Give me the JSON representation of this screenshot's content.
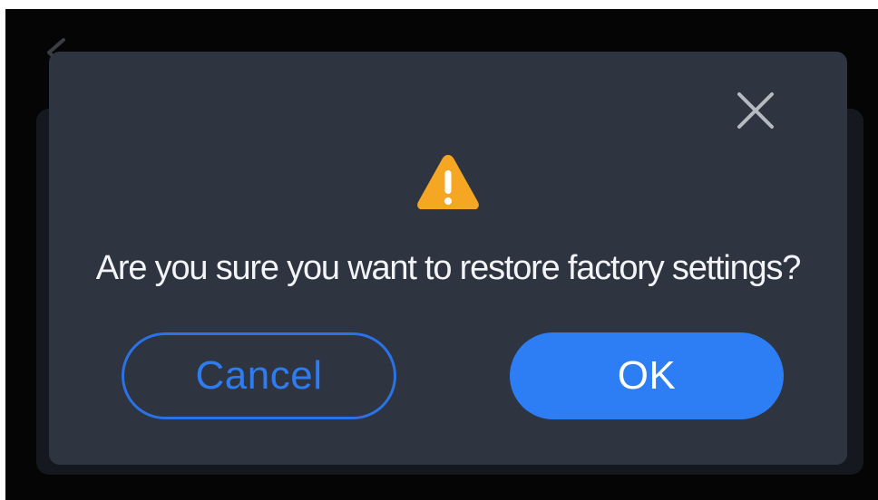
{
  "dialog": {
    "message": "Are you sure you want to restore factory settings?",
    "cancel_label": "Cancel",
    "ok_label": "OK"
  },
  "icons": {
    "back": "back-arrow-icon",
    "close": "close-icon",
    "warning": "warning-icon"
  },
  "colors": {
    "dialog_bg": "#2e3440",
    "accent": "#2d7ef4",
    "warning": "#f5a623",
    "screen_bg": "#050505"
  }
}
